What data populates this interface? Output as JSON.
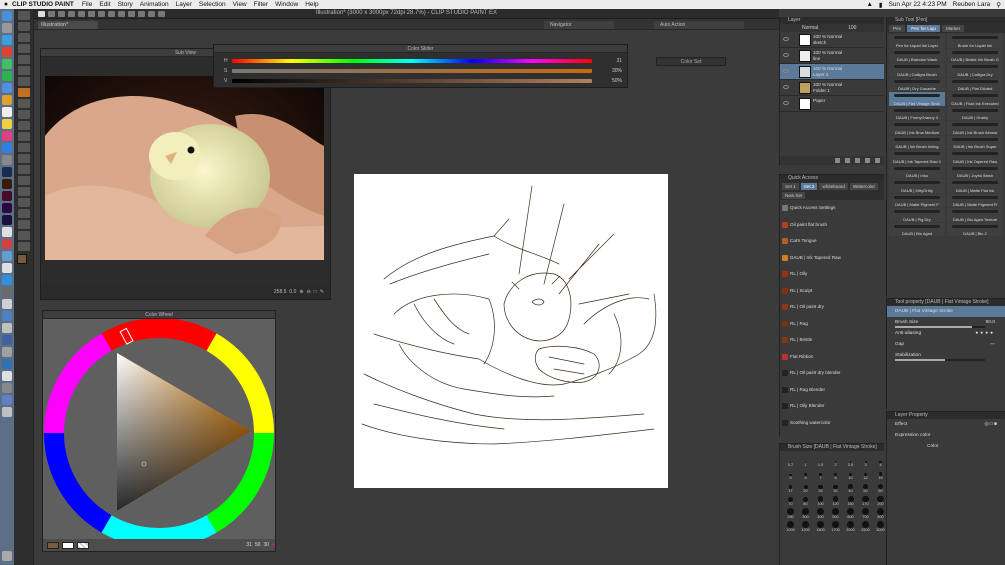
{
  "menubar": {
    "apple": "",
    "app_name": "CLIP STUDIO PAINT",
    "items": [
      "File",
      "Edit",
      "Story",
      "Animation",
      "Layer",
      "Selection",
      "View",
      "Filter",
      "Window",
      "Help"
    ],
    "datetime": "Sun Apr 22  4:23 PM",
    "user": "Reuben Lara"
  },
  "window_title": "Illustration* (3000 x 3000px 72dpi 28.7%)  -  CLIP STUDIO PAINT EX",
  "doc_tab": "Illustration*",
  "dock_tabs": {
    "navigator": "Navigator",
    "auto_action": "Auto Action",
    "color_set": "Color Set"
  },
  "sub_view": {
    "title": "Sub View",
    "zoom": "258.5",
    "angle": "0.0"
  },
  "color_slider": {
    "title": "Color Slider",
    "rows": [
      {
        "label": "H",
        "value": "31"
      },
      {
        "label": "S",
        "value": "30%"
      },
      {
        "label": "V",
        "value": "50%"
      }
    ]
  },
  "color_wheel": {
    "title": "Color Wheel",
    "values": [
      "31",
      "50",
      "30"
    ],
    "colors": {
      "main": "#7a5a3a",
      "sub": "#ffffff"
    }
  },
  "layer_panel": {
    "title": "Layer",
    "blend": "Normal",
    "opacity": "100",
    "layers": [
      {
        "line1": "100 % Normal",
        "line2": "sketch",
        "thumb": "#fff",
        "selected": false
      },
      {
        "line1": "100 % Normal",
        "line2": "line",
        "thumb": "#eee",
        "selected": false
      },
      {
        "line1": "100 % Normal",
        "line2": "Layer 1",
        "thumb": "#ddd",
        "selected": true
      },
      {
        "line1": "100 % Normal",
        "line2": "Folder 1",
        "thumb": "#444",
        "selected": false
      },
      {
        "line1": "",
        "line2": "Paper",
        "thumb": "#fff",
        "selected": false
      }
    ]
  },
  "quick_access": {
    "title": "Quick Access",
    "tabs": [
      "Set 1",
      "Set 2",
      "whiteboard",
      "Watercolor",
      "New Set"
    ],
    "items": [
      {
        "label": "Quick Access Settings",
        "color": "#777"
      },
      {
        "label": "Oil paint flat brush",
        "color": "#b04020"
      },
      {
        "label": "Cat's Tongue",
        "color": "#b06020"
      },
      {
        "label": "DAUB | Ink Tapered Raw",
        "color": "#d08020"
      },
      {
        "label": "RL | Oily",
        "color": "#a03010"
      },
      {
        "label": "RL | Sculpt",
        "color": "#803010"
      },
      {
        "label": "RL | Oil paint dry",
        "color": "#903515"
      },
      {
        "label": "RL | Rag",
        "color": "#7a3010"
      },
      {
        "label": "RL | Bristle",
        "color": "#853510"
      },
      {
        "label": "Flat Ribbon",
        "color": "#c03030"
      },
      {
        "label": "RL | Oil paint dry blender",
        "color": "#222"
      },
      {
        "label": "RL | Rag Blender",
        "color": "#222"
      },
      {
        "label": "RL | Oily Blender",
        "color": "#222"
      },
      {
        "label": "Soothing watercolor",
        "color": "#222"
      }
    ]
  },
  "brush_size": {
    "title": "Brush Size [DAUB | Flat Vintage Stroke]",
    "sizes": [
      "0.7",
      "1",
      "1.5",
      "2",
      "2.5",
      "3",
      "4",
      "5",
      "6",
      "7",
      "8",
      "10",
      "12",
      "15",
      "17",
      "20",
      "25",
      "30",
      "40",
      "50",
      "60",
      "70",
      "80",
      "100",
      "120",
      "150",
      "170",
      "200",
      "250",
      "300",
      "400",
      "500",
      "600",
      "700",
      "800",
      "1000",
      "1200",
      "1500",
      "1700",
      "2000",
      "2500",
      "3000"
    ]
  },
  "sub_tool": {
    "title": "Sub Tool [Pen]",
    "tabs": [
      "Pen",
      "Pen for Liqu",
      "Marker"
    ],
    "items": [
      "Pen for Liquid Ink Layer",
      "Brush for Liquid Ink",
      "DAUB | Brandon Wash",
      "DAUB | Bristle Ink Brush G",
      "DAUB | Calligra Brush",
      "DAUB | Calligra Dry",
      "DAUB | Dry Gouache",
      "DAUB | Flat Diluted",
      "DAUB | Flat Vintage Strok",
      "DAUB | Fluid Ink Executed",
      "DAUB | FunnyGranny 3",
      "DAUB | Gnarly",
      "DAUB | Ink Brus Medium",
      "DAUB | Ink Brush Almost",
      "DAUB | Ink Brush Inking",
      "DAUB | Ink Brush Super",
      "DAUB | Ink Tapered Raw 2",
      "DAUB | Ink Tapered Raw",
      "DAUB | Inko",
      "DAUB | Joyful Wash",
      "DAUB | KittyGritty",
      "DAUB | Matte Flat Ink",
      "DAUB | Matte Pigment F",
      "DAUB | Matte Pigment Fl",
      "DAUB | Pig Dry",
      "DAUB | Bio Aged Texture",
      "DAUB | Bio Aged",
      "DAUB | Bio 2"
    ]
  },
  "tool_property": {
    "title": "Tool property [DAUB | Flat Vintage Stroke]",
    "tool_name": "DAUB | Flat Vintage Stroke",
    "brush_size_label": "Brush Size",
    "brush_size_value": "90.0",
    "brush_size_fraction": 0.85,
    "antialias_label": "Anti-aliasing",
    "gap_label": "Gap",
    "stabilization_label": "Stabilization",
    "stabilization_fraction": 0.55
  },
  "layer_property": {
    "title": "Layer Property",
    "effect_label": "Effect",
    "expression_label": "Expression color",
    "expression_value": "Color"
  }
}
